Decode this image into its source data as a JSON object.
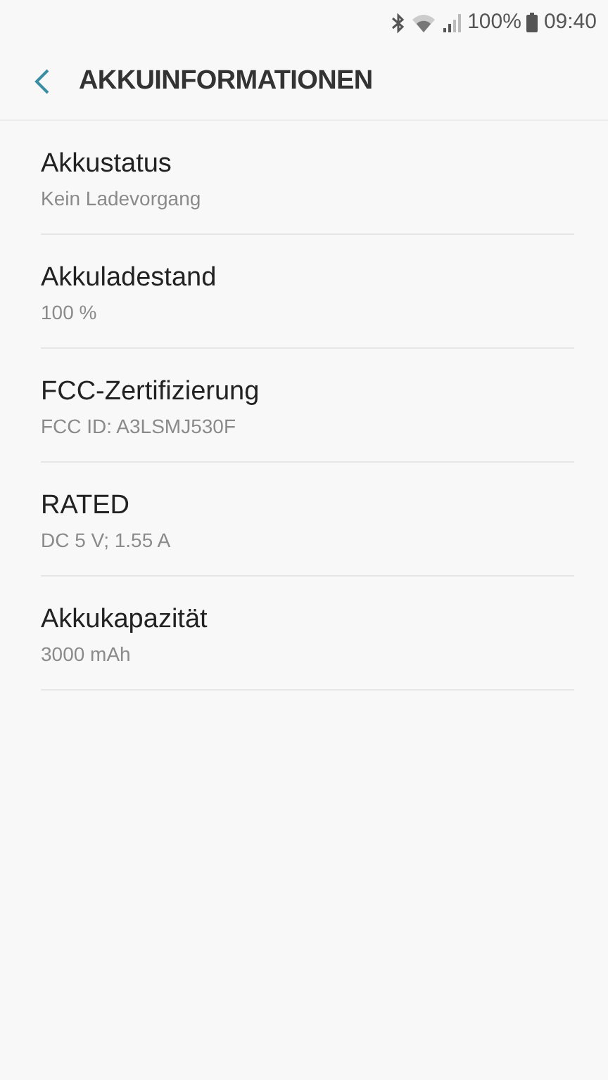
{
  "status_bar": {
    "battery_text": "100%",
    "time": "09:40"
  },
  "header": {
    "title": "AKKUINFORMATIONEN"
  },
  "items": [
    {
      "title": "Akkustatus",
      "subtitle": "Kein Ladevorgang"
    },
    {
      "title": "Akkuladestand",
      "subtitle": "100 %"
    },
    {
      "title": "FCC-Zertifizierung",
      "subtitle": "FCC ID: A3LSMJ530F"
    },
    {
      "title": "RATED",
      "subtitle": "DC 5 V; 1.55 A"
    },
    {
      "title": "Akkukapazität",
      "subtitle": "3000 mAh"
    }
  ]
}
